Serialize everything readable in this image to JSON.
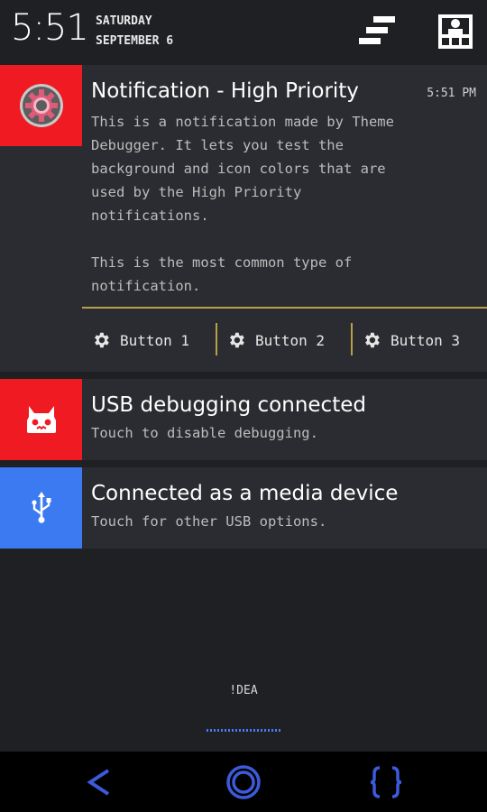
{
  "header": {
    "time": "5:51",
    "day": "SATURDAY",
    "date": "SEPTEMBER 6",
    "icons": [
      "quick-settings-icon",
      "user-profile-icon"
    ]
  },
  "notifications": [
    {
      "title": "Notification - High Priority",
      "time": "5:51 PM",
      "icon": "settings-gear-icon",
      "icon_bg": "#f01b22",
      "body_lines": [
        "This is a notification made by Theme",
        "Debugger. It lets you test the",
        "background and icon colors that are",
        "used by the High Priority",
        "notifications.",
        "",
        "This is the most common type of",
        "notification."
      ],
      "actions": [
        {
          "label": "Button 1",
          "icon": "gear-icon"
        },
        {
          "label": "Button 2",
          "icon": "gear-icon"
        },
        {
          "label": "Button 3",
          "icon": "gear-icon"
        }
      ]
    },
    {
      "title": "USB debugging connected",
      "subtitle": "Touch to disable debugging.",
      "icon": "cyanogenmod-mascot-icon",
      "icon_bg": "#f01b22"
    },
    {
      "title": "Connected as a media device",
      "subtitle": "Touch for other USB options.",
      "icon": "usb-icon",
      "icon_bg": "#3b7af0"
    }
  ],
  "footer": {
    "label": "!DEA"
  },
  "navbar": {
    "buttons": [
      "back-icon",
      "home-icon",
      "recents-icon"
    ],
    "accent": "#3b5bdb"
  },
  "colors": {
    "background": "#1f2024",
    "card": "#2b2c31",
    "divider": "#b8a04a"
  }
}
